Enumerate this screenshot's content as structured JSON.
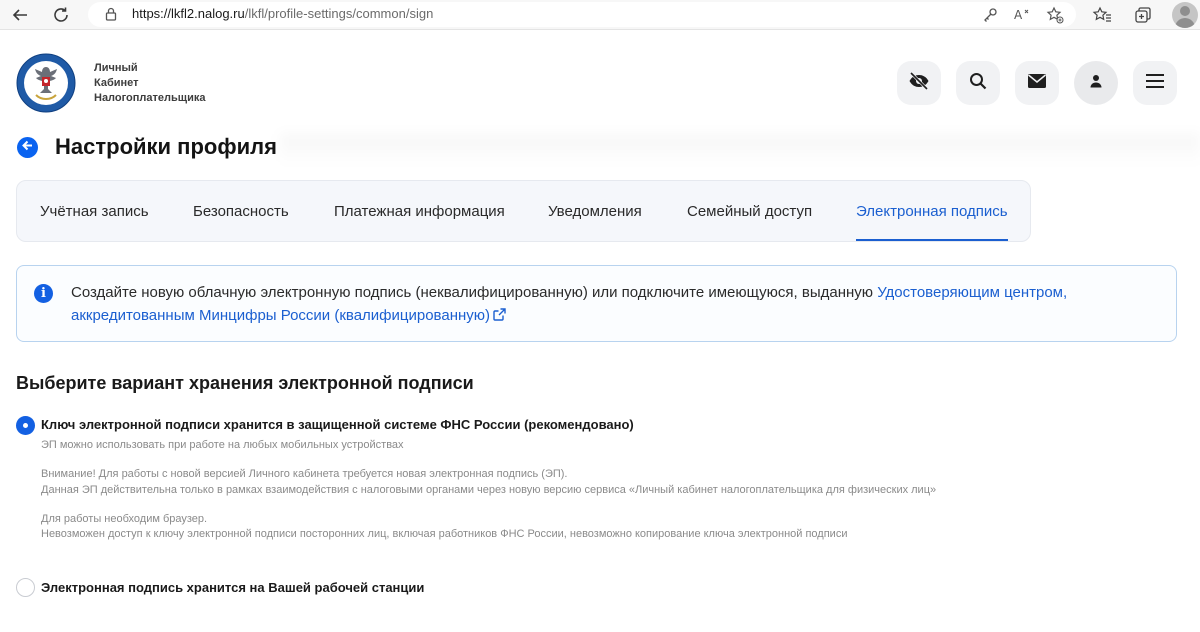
{
  "browser": {
    "url_host": "https://lkfl2.nalog.ru",
    "url_path": "/lkfl/profile-settings/common/sign",
    "icons": [
      "back-arrow-icon",
      "reload-icon",
      "lock-icon",
      "key-icon",
      "read-aloud-icon",
      "favorite-add-icon",
      "favorites-icon",
      "collections-icon",
      "profile-icon"
    ]
  },
  "header": {
    "brand_line1": "Личный",
    "brand_line2": "Кабинет",
    "brand_line3": "Налогоплательщика",
    "buttons": [
      "accessibility-eye-icon",
      "search-icon",
      "mail-icon",
      "user-icon",
      "menu-icon"
    ]
  },
  "page": {
    "title": "Настройки профиля"
  },
  "tabs": [
    {
      "label": "Учётная запись"
    },
    {
      "label": "Безопасность"
    },
    {
      "label": "Платежная информация"
    },
    {
      "label": "Уведомления"
    },
    {
      "label": "Семейный доступ"
    },
    {
      "label": "Электронная подпись",
      "active": true
    }
  ],
  "info": {
    "text": "Создайте новую облачную электронную подпись (неквалифицированную) или подключите имеющуюся, выданную ",
    "link_line1": "Удостоверяющим центром,",
    "link_line2": "аккредитованным Минцифры России (квалифицированную)"
  },
  "section": {
    "title": "Выберите вариант хранения электронной подписи",
    "option1": {
      "label": "Ключ электронной подписи хранится в защищенной системе ФНС России (рекомендовано)",
      "checked": true,
      "note1": "ЭП можно использовать при работе на любых мобильных устройствах",
      "note2": "Внимание! Для работы с новой версией Личного кабинета требуется новая электронная подпись (ЭП).",
      "note3": "Данная ЭП действительна только в рамках взаимодействия с налоговыми органами через новую версию сервиса «Личный кабинет налогоплательщика для физических лиц»",
      "note4": "Для работы необходим браузер.",
      "note5": "Невозможен доступ к ключу электронной подписи посторонних лиц, включая работников ФНС России, невозможно копирование ключа электронной подписи"
    },
    "option2": {
      "label": "Электронная подпись хранится на Вашей рабочей станции",
      "checked": false
    }
  },
  "colors": {
    "accent": "#1360e2",
    "link": "#1b5fd0",
    "info_border": "#b8d3ef",
    "tabs_bg": "#f5f7fb"
  }
}
